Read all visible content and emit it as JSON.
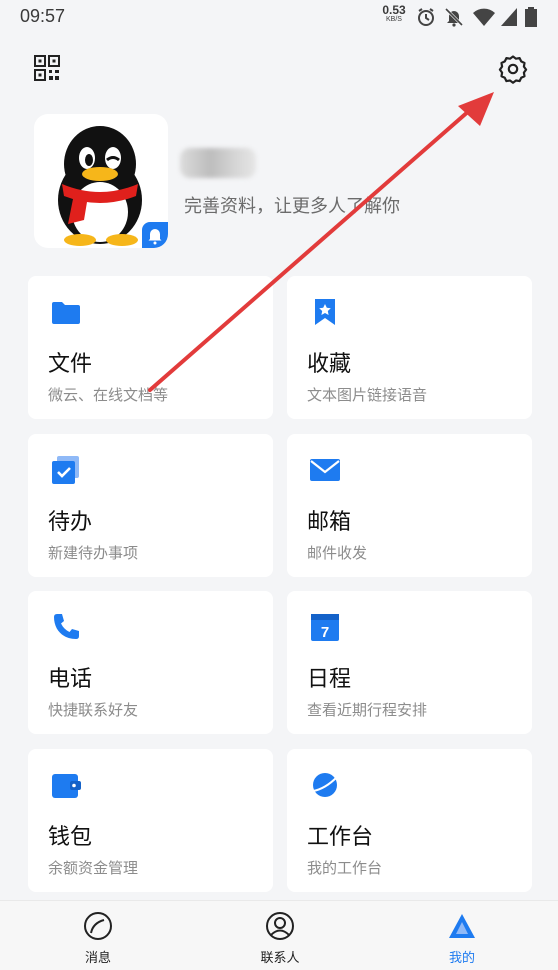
{
  "status_bar": {
    "time": "09:57",
    "net_speed_value": "0.53",
    "net_speed_unit": "KB/S",
    "icons": [
      "alarm-icon",
      "bell-off-icon",
      "wifi-icon",
      "signal-icon",
      "battery-icon"
    ]
  },
  "header": {
    "left_icon": "qr-code-icon",
    "right_icon": "settings-gear-icon"
  },
  "profile": {
    "nickname": "",
    "subtitle": "完善资料，让更多人了解你"
  },
  "grid": [
    {
      "title": "文件",
      "desc": "微云、在线文档等",
      "icon": "folder-icon"
    },
    {
      "title": "收藏",
      "desc": "文本图片链接语音",
      "icon": "bookmark-star-icon"
    },
    {
      "title": "待办",
      "desc": "新建待办事项",
      "icon": "todo-check-icon"
    },
    {
      "title": "邮箱",
      "desc": "邮件收发",
      "icon": "mail-icon"
    },
    {
      "title": "电话",
      "desc": "快捷联系好友",
      "icon": "phone-icon"
    },
    {
      "title": "日程",
      "desc": "查看近期行程安排",
      "icon": "calendar-icon"
    },
    {
      "title": "钱包",
      "desc": "余额资金管理",
      "icon": "wallet-icon"
    },
    {
      "title": "工作台",
      "desc": "我的工作台",
      "icon": "planet-icon"
    }
  ],
  "calendar_day": "7",
  "tabs": [
    {
      "label": "消息",
      "icon": "chat-bubble-icon",
      "active": false
    },
    {
      "label": "联系人",
      "icon": "contact-person-icon",
      "active": false
    },
    {
      "label": "我的",
      "icon": "my-triangle-icon",
      "active": true
    }
  ],
  "colors": {
    "accent": "#1e7bf0",
    "background": "#f4f5f7",
    "card": "#ffffff",
    "annotation_arrow": "#e23b3b"
  }
}
